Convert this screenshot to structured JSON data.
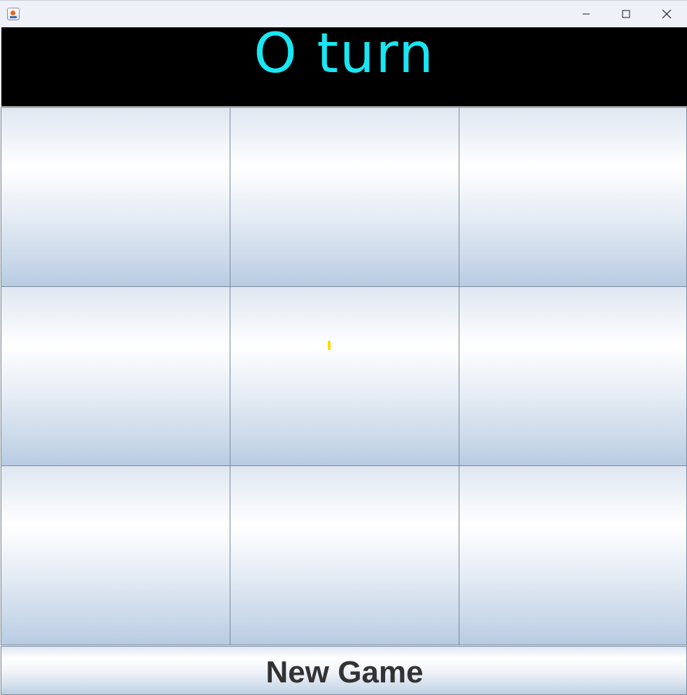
{
  "window": {
    "controls": [
      "minimize-icon",
      "maximize-icon",
      "close-icon"
    ]
  },
  "banner": {
    "turn_text": "O turn",
    "text_color": "#19e6f2",
    "background": "#000000"
  },
  "board": {
    "rows": 3,
    "columns": 3,
    "cells": [
      "",
      "",
      "",
      "",
      "",
      "",
      "",
      "",
      ""
    ]
  },
  "new_game": {
    "label": "New Game"
  }
}
